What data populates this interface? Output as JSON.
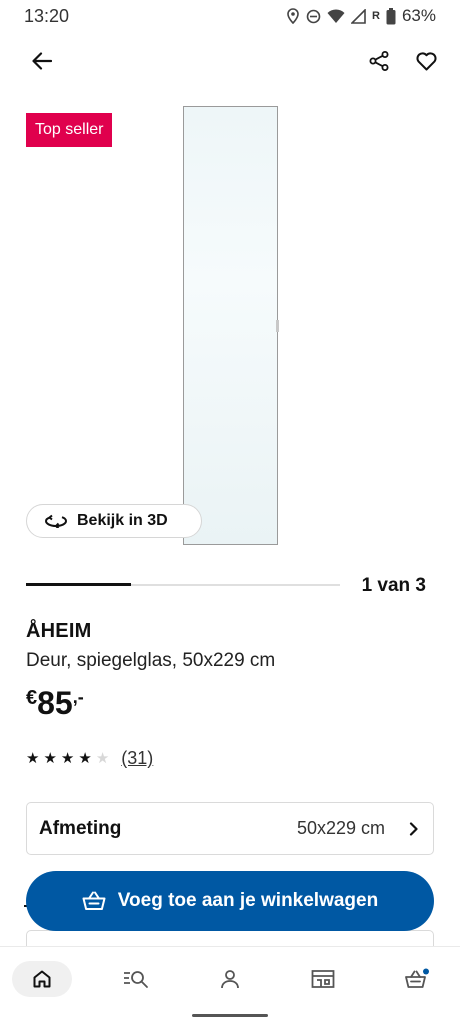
{
  "status": {
    "time": "13:20",
    "battery": "63%",
    "roaming": "R"
  },
  "app_bar": {
    "back_icon": "arrow-left-icon",
    "share_icon": "share-icon",
    "favorite_icon": "heart-icon"
  },
  "hero": {
    "badge": "Top seller",
    "view3d_label": "Bekijk in 3D"
  },
  "pager": {
    "label": "1 van 3",
    "current": 1,
    "total": 3
  },
  "product": {
    "name": "ÅHEIM",
    "description": "Deur, spiegelglas, 50x229 cm",
    "price_currency": "€",
    "price_amount": "85",
    "price_decimals": ",-",
    "rating": 4,
    "rating_max": 5,
    "review_count": "(31)"
  },
  "size": {
    "label": "Afmeting",
    "value": "50x229 cm"
  },
  "cart": {
    "label": "Voeg toe aan je winkelwagen"
  },
  "nav": {
    "items": [
      "home-icon",
      "search-list-icon",
      "account-icon",
      "store-icon",
      "cart-icon"
    ],
    "cart_dot_color": "#0058a3"
  },
  "colors": {
    "badge": "#e0004d",
    "primary": "#0058a3"
  }
}
